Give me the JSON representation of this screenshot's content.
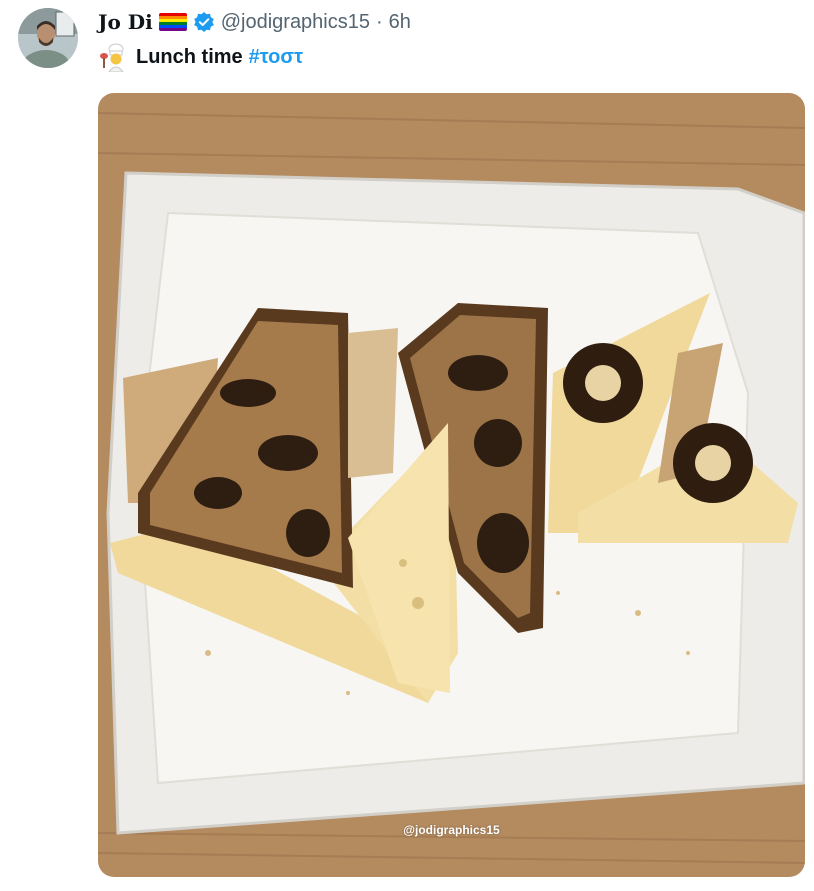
{
  "tweet": {
    "author": {
      "display_name": "Jo Di",
      "handle": "@jodigraphics15",
      "badges": [
        "pride-flag-icon",
        "verified-badge-icon"
      ]
    },
    "separator": "·",
    "time": "6h",
    "text": {
      "emoji": "cook-emoji-icon",
      "body": "Lunch time",
      "hashtag": "#τοστ"
    },
    "media": {
      "watermark": "@jodigraphics15"
    }
  },
  "colors": {
    "text_primary": "#0f1419",
    "text_secondary": "#536471",
    "link": "#1d9bf0",
    "verified": "#1d9bf0"
  }
}
